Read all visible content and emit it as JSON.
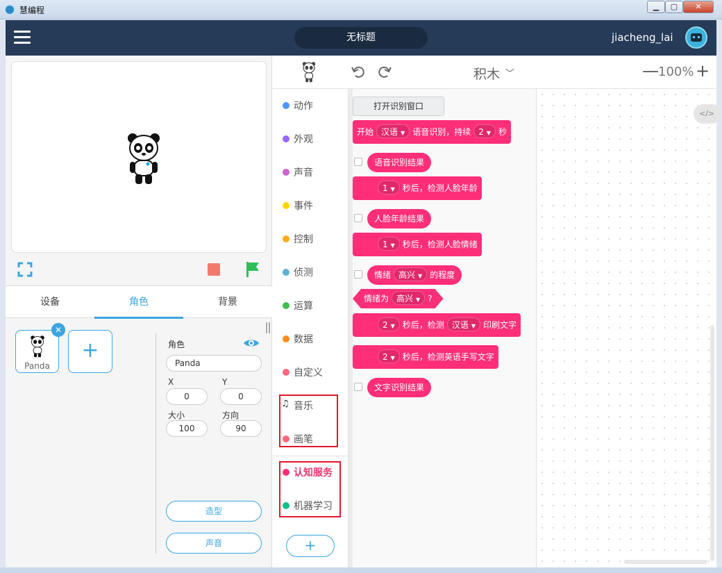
{
  "window": {
    "title": "慧编程",
    "min": "0",
    "max": "1",
    "close": "r"
  },
  "header": {
    "project_title": "无标题",
    "username": "jiacheng_lai"
  },
  "tabs": [
    {
      "label": "设备",
      "active": false
    },
    {
      "label": "角色",
      "active": true
    },
    {
      "label": "背景",
      "active": false
    }
  ],
  "sprite": {
    "name": "Panda",
    "delete": "✕",
    "add": "+"
  },
  "props": {
    "role_label": "角色",
    "name_value": "Panda",
    "x_label": "X",
    "x_value": "0",
    "y_label": "Y",
    "y_value": "0",
    "size_label": "大小",
    "size_value": "100",
    "dir_label": "方向",
    "dir_value": "90",
    "costume_button": "造型",
    "sound_button": "声音"
  },
  "toolbar": {
    "mode": "积木",
    "zoom_minus": "—",
    "zoom_level": "100%",
    "zoom_plus": "+"
  },
  "categories": [
    {
      "label": "动作",
      "color": "#4c97ff"
    },
    {
      "label": "外观",
      "color": "#9966ff"
    },
    {
      "label": "声音",
      "color": "#cf63cf"
    },
    {
      "label": "事件",
      "color": "#ffd500"
    },
    {
      "label": "控制",
      "color": "#ffab19"
    },
    {
      "label": "侦测",
      "color": "#5cb1d6"
    },
    {
      "label": "运算",
      "color": "#40bf4a"
    },
    {
      "label": "数据",
      "color": "#ff8c1a"
    },
    {
      "label": "自定义",
      "color": "#ff6680"
    },
    {
      "label": "音乐",
      "color": "#333333",
      "icon": "music-note-icon"
    },
    {
      "label": "画笔",
      "color": "#ff6680"
    },
    {
      "label": "认知服务",
      "color": "#ff2e79",
      "active": true
    },
    {
      "label": "机器学习",
      "color": "#0fbd8c"
    }
  ],
  "add_extension": "+",
  "blocks": {
    "open_window": "打开识别窗口",
    "b1": {
      "t1": "开始",
      "dd1": "汉语",
      "t2": "语音识别，持续",
      "dd2": "2",
      "t3": "秒"
    },
    "b2": "语音识别结果",
    "b3": {
      "dd": "1",
      "t": "秒后，检测人脸年龄"
    },
    "b4": "人脸年龄结果",
    "b5": {
      "dd": "1",
      "t": "秒后，检测人脸情绪"
    },
    "b6": {
      "t1": "情绪",
      "dd": "高兴",
      "t2": "的程度"
    },
    "b7": {
      "t1": "情绪为",
      "dd": "高兴",
      "t2": "?"
    },
    "b8": {
      "dd1": "2",
      "t1": "秒后，检测",
      "dd2": "汉语",
      "t2": "印刷文字"
    },
    "b9": {
      "dd": "2",
      "t": "秒后，检测英语手写文字"
    },
    "b10": "文字识别结果"
  },
  "workspace": {
    "code_toggle": "</>"
  },
  "colors": {
    "accent": "#3aa6e0",
    "header": "#253b57",
    "block": "#ff2e79",
    "highlight_box": "#e0182a"
  }
}
